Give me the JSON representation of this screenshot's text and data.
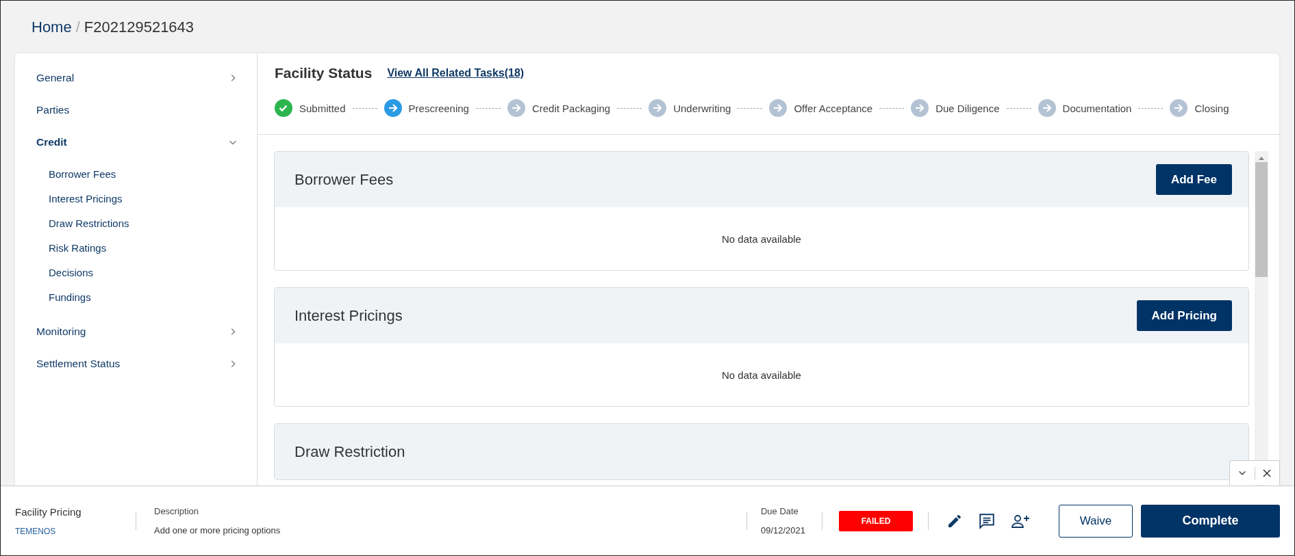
{
  "breadcrumb": {
    "home": "Home",
    "separator": "/",
    "current": "F202129521643"
  },
  "sidebar": {
    "items": [
      {
        "label": "General",
        "expanded": false,
        "selected": false
      },
      {
        "label": "Parties",
        "selected": false
      },
      {
        "label": "Credit",
        "expanded": true,
        "selected": true,
        "children": [
          {
            "label": "Borrower Fees"
          },
          {
            "label": "Interest Pricings"
          },
          {
            "label": "Draw Restrictions"
          },
          {
            "label": "Risk Ratings"
          },
          {
            "label": "Decisions"
          },
          {
            "label": "Fundings"
          }
        ]
      },
      {
        "label": "Monitoring",
        "expanded": false,
        "selected": false
      },
      {
        "label": "Settlement Status",
        "expanded": false,
        "selected": false
      }
    ]
  },
  "facility_status": {
    "title": "Facility Status",
    "link": "View All Related Tasks(18)",
    "steps": [
      {
        "label": "Submitted",
        "completed": true,
        "selected": false
      },
      {
        "label": "Prescreening",
        "completed": false,
        "selected": true
      },
      {
        "label": "Credit Packaging",
        "completed": false,
        "selected": false
      },
      {
        "label": "Underwriting",
        "completed": false,
        "selected": false
      },
      {
        "label": "Offer Acceptance",
        "completed": false,
        "selected": false
      },
      {
        "label": "Due Diligence",
        "completed": false,
        "selected": false
      },
      {
        "label": "Documentation",
        "completed": false,
        "selected": false
      },
      {
        "label": "Closing",
        "completed": false,
        "selected": false
      }
    ]
  },
  "sections": [
    {
      "title": "Borrower Fees",
      "button": "Add Fee",
      "empty_text": "No data available"
    },
    {
      "title": "Interest Pricings",
      "button": "Add Pricing",
      "empty_text": "No data available"
    },
    {
      "title": "Draw Restriction"
    }
  ],
  "task_bar": {
    "title": "Facility Pricing",
    "owner": "TEMENOS",
    "description_label": "Description",
    "description": "Add one or more pricing options",
    "due_label": "Due Date",
    "due_date": "09/12/2021",
    "status": "FAILED",
    "buttons": [
      "Waive",
      "Complete"
    ]
  }
}
